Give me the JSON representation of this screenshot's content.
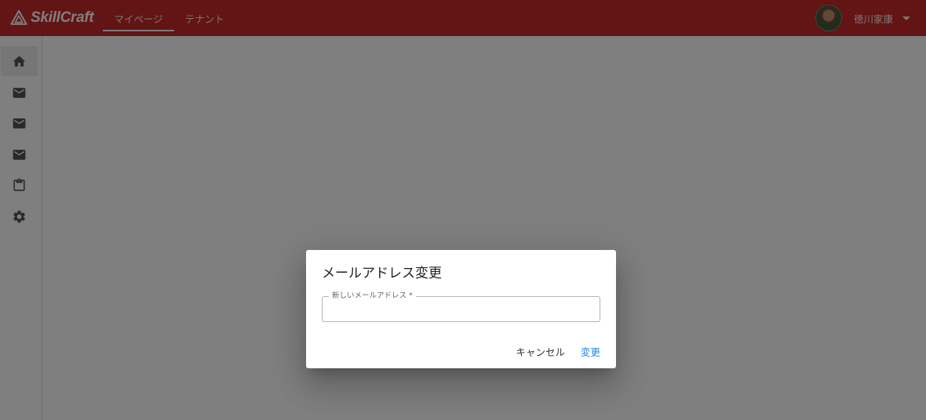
{
  "app": {
    "brand": "SkillCraft",
    "brand_color": "#c62828"
  },
  "nav": {
    "tabs": [
      {
        "label": "マイページ",
        "active": true
      },
      {
        "label": "テナント",
        "active": false
      }
    ]
  },
  "user": {
    "name": "徳川家康",
    "avatar_icon": "user-avatar"
  },
  "sidebar": {
    "items": [
      {
        "icon": "home-icon",
        "active": true
      },
      {
        "icon": "mail-icon",
        "active": false
      },
      {
        "icon": "mail-icon",
        "active": false
      },
      {
        "icon": "mail-icon",
        "active": false
      },
      {
        "icon": "clipboard-icon",
        "active": false
      },
      {
        "icon": "gear-icon",
        "active": false
      }
    ]
  },
  "dialog": {
    "title": "メールアドレス変更",
    "field": {
      "label": "新しいメールアドレス *",
      "value": "",
      "required": true
    },
    "cancel_label": "キャンセル",
    "confirm_label": "変更",
    "confirm_color": "#1e88e5"
  }
}
